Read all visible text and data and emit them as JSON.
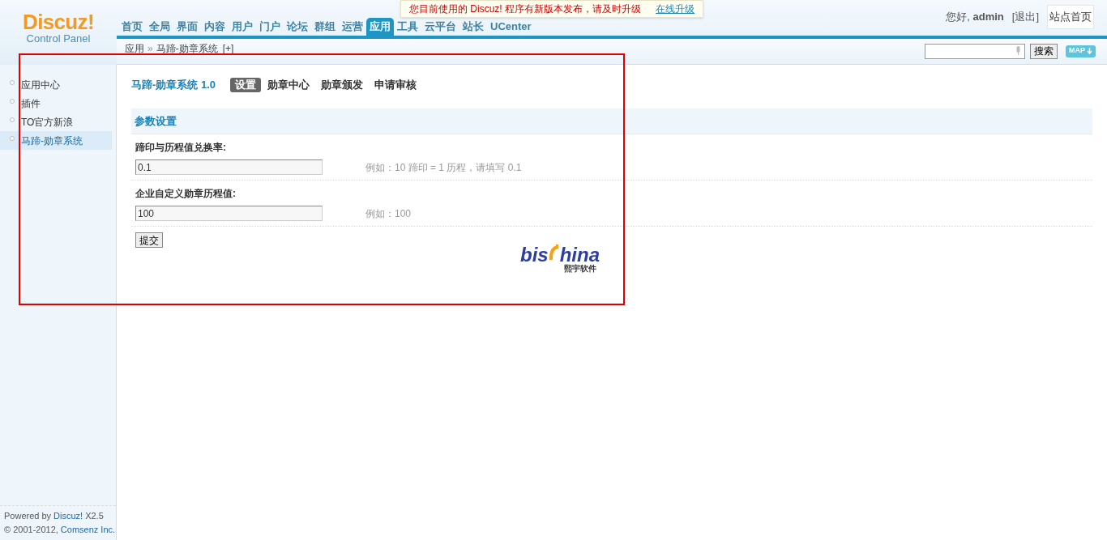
{
  "logo": {
    "name": "Discuz!",
    "subtitle": "Control Panel"
  },
  "nav": [
    {
      "label": "首页",
      "selected": false
    },
    {
      "label": "全局",
      "selected": false
    },
    {
      "label": "界面",
      "selected": false
    },
    {
      "label": "内容",
      "selected": false
    },
    {
      "label": "用户",
      "selected": false
    },
    {
      "label": "门户",
      "selected": false
    },
    {
      "label": "论坛",
      "selected": false
    },
    {
      "label": "群组",
      "selected": false
    },
    {
      "label": "运营",
      "selected": false
    },
    {
      "label": "应用",
      "selected": true
    },
    {
      "label": "工具",
      "selected": false
    },
    {
      "label": "云平台",
      "selected": false
    },
    {
      "label": "站长",
      "selected": false
    },
    {
      "label": "UCenter",
      "selected": false
    }
  ],
  "notice": {
    "text": "您目前使用的 Discuz! 程序有新版本发布，请及时升级",
    "link": "在线升级"
  },
  "user": {
    "greeting": "您好,",
    "name": "admin",
    "logout": "[退出]",
    "home": "站点首页"
  },
  "breadcrumb": {
    "parent": "应用",
    "separator": "»",
    "current": "马蹄-勋章系统",
    "add": "[+]"
  },
  "search": {
    "button": "搜索",
    "map": "MAP"
  },
  "sidebar": {
    "items": [
      {
        "label": "应用中心",
        "selected": false
      },
      {
        "label": "插件",
        "selected": false
      },
      {
        "label": "TO官方新浪",
        "selected": false
      },
      {
        "label": "马蹄-勋章系统",
        "selected": true
      }
    ]
  },
  "plugin": {
    "title": "马蹄-勋章系统 1.0",
    "tabs": [
      {
        "label": "设置",
        "selected": true
      },
      {
        "label": "勋章中心",
        "selected": false
      },
      {
        "label": "勋章颁发",
        "selected": false
      },
      {
        "label": "申请审核",
        "selected": false
      }
    ]
  },
  "form": {
    "section": "参数设置",
    "fields": [
      {
        "label": "蹄印与历程值兑换率:",
        "value": "0.1",
        "hint": "例如：10 蹄印 = 1 历程，请填写 0.1"
      },
      {
        "label": "企业自定义勋章历程值:",
        "value": "100",
        "hint": "例如：100"
      }
    ],
    "submit": "提交"
  },
  "brand": {
    "part1": "bis",
    "part2": "hina",
    "tagline": "熙宇软件"
  },
  "footer": [
    {
      "text": "Powered by",
      "link": "Discuz!",
      "suffix": "X2.5"
    },
    {
      "text": "© 2001-2012,",
      "link": "Comsenz Inc."
    }
  ]
}
